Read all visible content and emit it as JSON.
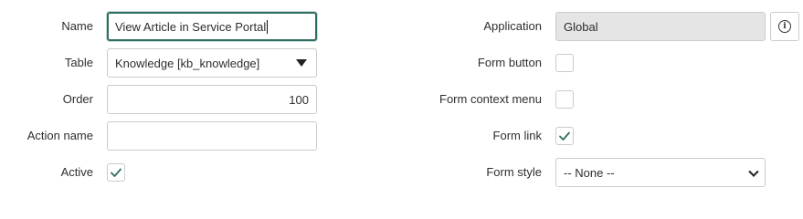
{
  "left_fields": {
    "name": {
      "label": "Name",
      "value": "View Article in Service Portal"
    },
    "table": {
      "label": "Table",
      "value": "Knowledge [kb_knowledge]"
    },
    "order": {
      "label": "Order",
      "value": "100"
    },
    "action_name": {
      "label": "Action name",
      "value": ""
    },
    "active": {
      "label": "Active",
      "checked": true
    }
  },
  "right_fields": {
    "application": {
      "label": "Application",
      "value": "Global"
    },
    "form_button": {
      "label": "Form button",
      "checked": false
    },
    "form_context_menu": {
      "label": "Form context menu",
      "checked": false
    },
    "form_link": {
      "label": "Form link",
      "checked": true
    },
    "form_style": {
      "label": "Form style",
      "value": "-- None --"
    }
  },
  "colors": {
    "check": "#2f6e62",
    "focus_border": "#2f6e62",
    "border": "#cbcbcb",
    "readonly_bg": "#e5e5e5"
  },
  "icons": {
    "info": "info-icon",
    "check": "checkmark-icon"
  }
}
